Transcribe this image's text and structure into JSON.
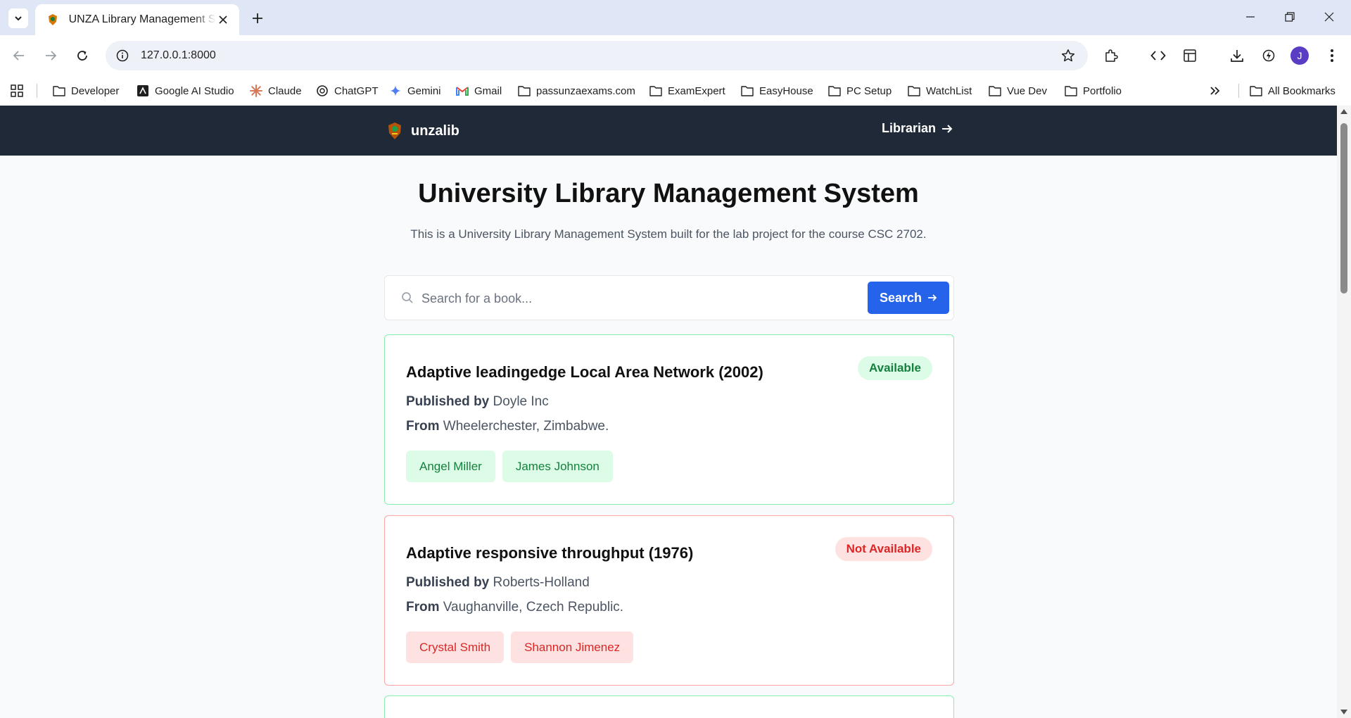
{
  "browser": {
    "tab_title": "UNZA Library Management System",
    "url": "127.0.0.1:8000",
    "avatar_letter": "J",
    "bookmarks": [
      {
        "label": "Developer",
        "icon": "folder-icon"
      },
      {
        "label": "Google AI Studio",
        "icon": "ai-studio-icon"
      },
      {
        "label": "Claude",
        "icon": "claude-icon"
      },
      {
        "label": "ChatGPT",
        "icon": "chatgpt-icon"
      },
      {
        "label": "Gemini",
        "icon": "gemini-icon"
      },
      {
        "label": "Gmail",
        "icon": "gmail-icon"
      },
      {
        "label": "passunzaexams.com",
        "icon": "folder-icon"
      },
      {
        "label": "ExamExpert",
        "icon": "folder-icon"
      },
      {
        "label": "EasyHouse",
        "icon": "folder-icon"
      },
      {
        "label": "PC Setup",
        "icon": "folder-icon"
      },
      {
        "label": "WatchList",
        "icon": "folder-icon"
      },
      {
        "label": "Vue Dev",
        "icon": "folder-icon"
      },
      {
        "label": "Portfolio",
        "icon": "folder-icon"
      }
    ],
    "all_bookmarks_label": "All Bookmarks"
  },
  "app": {
    "brand": "unzalib",
    "nav_link": "Librarian",
    "title": "University Library Management System",
    "subtitle": "This is a University Library Management System built for the lab project for the course CSC 2702.",
    "search": {
      "placeholder": "Search for a book...",
      "button_label": "Search"
    },
    "colors": {
      "available": "#15803d",
      "not_available": "#dc2626",
      "primary": "#2563eb",
      "navbar": "#1f2937"
    }
  },
  "books": [
    {
      "title": "Adaptive leadingedge Local Area Network (2002)",
      "status": "Available",
      "published_by_label": "Published by",
      "publisher": "Doyle Inc",
      "from_label": "From",
      "location": "Wheelerchester, Zimbabwe.",
      "authors": [
        "Angel Miller",
        "James Johnson"
      ]
    },
    {
      "title": "Adaptive responsive throughput (1976)",
      "status": "Not Available",
      "published_by_label": "Published by",
      "publisher": "Roberts-Holland",
      "from_label": "From",
      "location": "Vaughanville, Czech Republic.",
      "authors": [
        "Crystal Smith",
        "Shannon Jimenez"
      ]
    }
  ]
}
